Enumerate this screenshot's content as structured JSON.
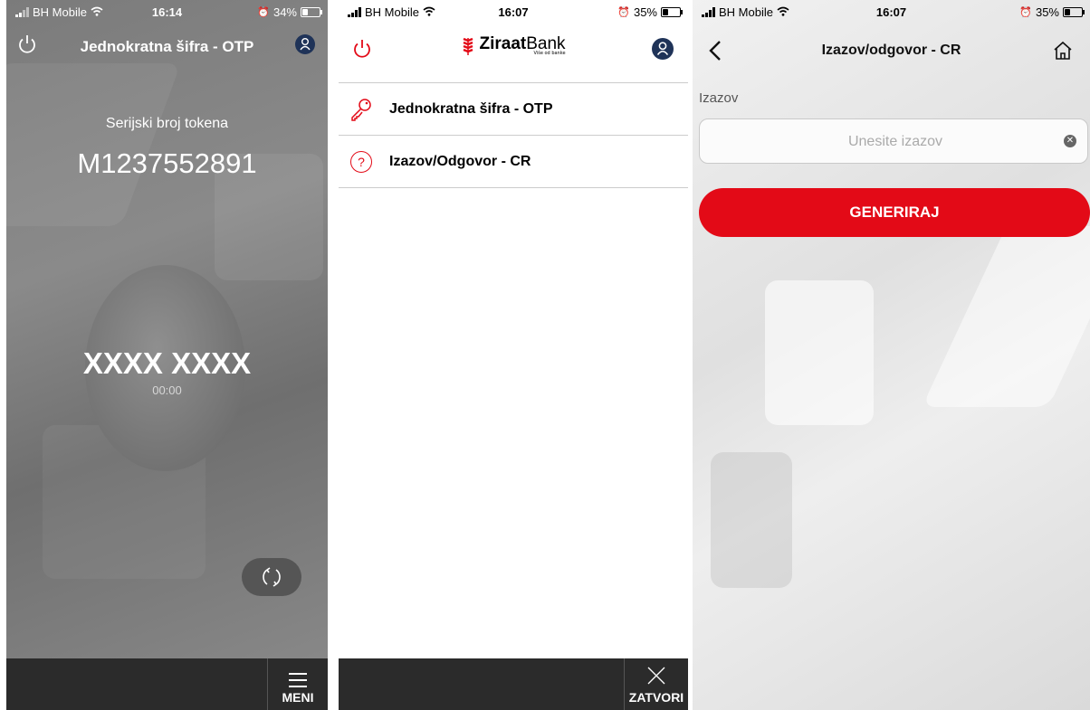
{
  "screens": {
    "otp": {
      "statusbar": {
        "carrier": "BH Mobile",
        "time": "16:14",
        "battery": "34%"
      },
      "title": "Jednokratna šifra - OTP",
      "serial_label": "Serijski broj tokena",
      "serial_number": "M1237552891",
      "code": "XXXX XXXX",
      "timer": "00:00",
      "footer_button": "MENI",
      "battery_level": 0.34
    },
    "menu": {
      "statusbar": {
        "carrier": "BH Mobile",
        "time": "16:07",
        "battery": "35%"
      },
      "logo": {
        "name": "Ziraat",
        "suffix": "Bank",
        "tagline": "Više od banke"
      },
      "items": [
        {
          "label": "Jednokratna šifra - OTP",
          "icon": "key-icon"
        },
        {
          "label": "Izazov/Odgovor - CR",
          "icon": "question-circle-icon",
          "glyph": "?"
        }
      ],
      "footer_button": "ZATVORI",
      "battery_level": 0.35
    },
    "cr": {
      "statusbar": {
        "carrier": "BH Mobile",
        "time": "16:07",
        "battery": "35%"
      },
      "title": "Izazov/odgovor - CR",
      "field_label": "Izazov",
      "input_placeholder": "Unesite izazov",
      "input_value": "",
      "generate_button": "GENERIRAJ",
      "battery_level": 0.35
    }
  },
  "colors": {
    "accent": "#e30a17",
    "footer": "#2b2b2b",
    "avatar": "#1f3358"
  }
}
